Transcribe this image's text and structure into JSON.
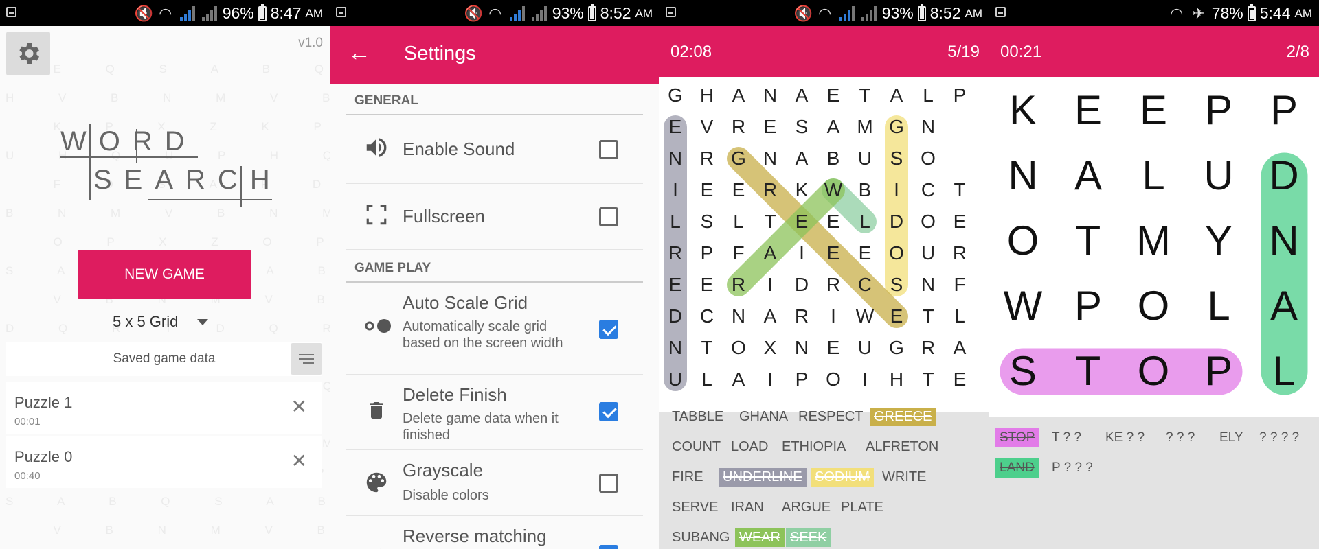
{
  "screen1": {
    "status": {
      "battery": "96%",
      "time": "8:47",
      "ampm": "AM"
    },
    "version": "v1.0",
    "logo": {
      "line1": "WORD",
      "line2": "SEARCH"
    },
    "new_game": "NEW GAME",
    "grid_size": "5 x 5 Grid",
    "saved_label": "Saved game data",
    "puzzles": [
      {
        "name": "Puzzle 1",
        "duration": "00:01"
      },
      {
        "name": "Puzzle 0",
        "duration": "00:40"
      }
    ],
    "icons": {
      "settings": "gear-icon",
      "close": "close-icon",
      "sort": "list-icon"
    }
  },
  "screen2": {
    "status": {
      "battery": "93%",
      "time": "8:52",
      "ampm": "AM"
    },
    "title": "Settings",
    "sections": {
      "general": "GENERAL",
      "gameplay": "GAME PLAY"
    },
    "items": [
      {
        "title": "Enable Sound",
        "subtitle": "",
        "checked": false,
        "icon": "speaker-icon"
      },
      {
        "title": "Fullscreen",
        "subtitle": "",
        "checked": false,
        "icon": "fullscreen-icon"
      },
      {
        "title": "Auto Scale Grid",
        "subtitle": "Automatically scale grid based on the screen width",
        "checked": true,
        "icon": "toggle-icon"
      },
      {
        "title": "Delete Finish",
        "subtitle": "Delete game data when it finished",
        "checked": true,
        "icon": "trash-icon"
      },
      {
        "title": "Grayscale",
        "subtitle": "Disable colors",
        "checked": false,
        "icon": "palette-icon"
      },
      {
        "title": "Reverse matching",
        "subtitle": "",
        "checked": true,
        "icon": "reverse-icon"
      }
    ],
    "accent": "#de1c5f",
    "checkbox_color": "#2a7de1"
  },
  "screen3": {
    "status": {
      "battery": "93%",
      "time": "8:52",
      "ampm": "AM"
    },
    "timer": "02:08",
    "progress": "5/19",
    "grid": [
      "GHANAETALP",
      "EVRESAMGN",
      "NRGNABUSO",
      "IEERKWBICT",
      "LSLTEELDOE",
      "RPFAIEEOUR",
      "EERIDRCSNF",
      "DCNARIWETL",
      "NTOXNEUGRA",
      "ULAIPOIHTE"
    ],
    "words": [
      {
        "text": "TABBLE",
        "done": false,
        "color": ""
      },
      {
        "text": "GHANA",
        "done": false,
        "color": ""
      },
      {
        "text": "RESPECT",
        "done": false,
        "color": ""
      },
      {
        "text": "GREECE",
        "done": true,
        "color": "#c9b04a"
      },
      {
        "text": "COUNT",
        "done": false,
        "color": ""
      },
      {
        "text": "LOAD",
        "done": false,
        "color": ""
      },
      {
        "text": "ETHIOPIA",
        "done": false,
        "color": ""
      },
      {
        "text": "ALFRETON",
        "done": false,
        "color": ""
      },
      {
        "text": "FIRE",
        "done": false,
        "color": ""
      },
      {
        "text": "UNDERLINE",
        "done": true,
        "color": "#9a9aaa"
      },
      {
        "text": "SODIUM",
        "done": true,
        "color": "#f2df7a"
      },
      {
        "text": "WRITE",
        "done": false,
        "color": ""
      },
      {
        "text": "SERVE",
        "done": false,
        "color": ""
      },
      {
        "text": "IRAN",
        "done": false,
        "color": ""
      },
      {
        "text": "ARGUE",
        "done": false,
        "color": ""
      },
      {
        "text": "PLATE",
        "done": false,
        "color": ""
      },
      {
        "text": "SUBANG",
        "done": false,
        "color": ""
      },
      {
        "text": "WEAR",
        "done": true,
        "color": "#8dc35a"
      },
      {
        "text": "SEEK",
        "done": true,
        "color": "#8fcfa3"
      }
    ]
  },
  "screen4": {
    "status": {
      "battery": "78%",
      "time": "5:44",
      "ampm": "AM"
    },
    "timer": "00:21",
    "progress": "2/8",
    "grid": [
      "KEEPP",
      "NALUD",
      "OTMYN",
      "WPOLA",
      "STOPL"
    ],
    "words": [
      {
        "text": "STOP",
        "done": true,
        "color": "#e27ce8"
      },
      {
        "text": "T ? ?",
        "done": false,
        "color": ""
      },
      {
        "text": "KE ? ?",
        "done": false,
        "color": ""
      },
      {
        "text": "? ? ?",
        "done": false,
        "color": ""
      },
      {
        "text": "ELY",
        "done": false,
        "color": ""
      },
      {
        "text": "? ? ? ?",
        "done": false,
        "color": ""
      },
      {
        "text": "LAND",
        "done": true,
        "color": "#4dcf8c"
      },
      {
        "text": "P ? ? ?",
        "done": false,
        "color": ""
      }
    ]
  }
}
